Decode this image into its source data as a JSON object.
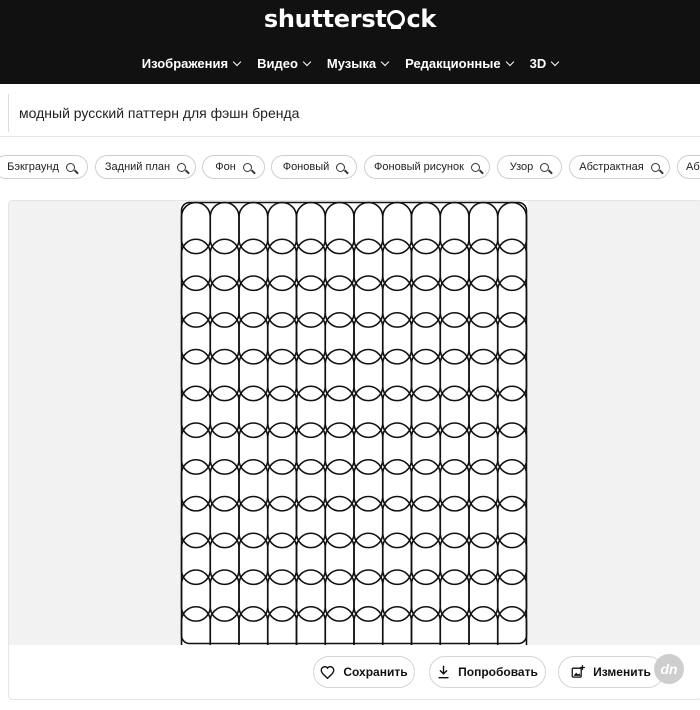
{
  "header": {
    "logo_left": "shutterst",
    "logo_right": "ck",
    "nav": [
      {
        "label": "Изображения"
      },
      {
        "label": "Видео"
      },
      {
        "label": "Музыка"
      },
      {
        "label": "Редакционные"
      },
      {
        "label": "3D"
      }
    ]
  },
  "search": {
    "query": "модный русский паттерн для фэшн бренда"
  },
  "chips": [
    {
      "label": "Бэкграунд"
    },
    {
      "label": "Задний план"
    },
    {
      "label": "Фон"
    },
    {
      "label": "Фоновый"
    },
    {
      "label": "Фоновый рисунок"
    },
    {
      "label": "Узор"
    },
    {
      "label": "Абстрактная"
    },
    {
      "label": "Аб"
    }
  ],
  "actions": {
    "save": "Сохранить",
    "try": "Попробовать",
    "edit": "Изменить"
  },
  "badge": "dn",
  "pattern": {
    "columns": 12,
    "rows": 12,
    "stroke_color": "#111111",
    "background": "#ffffff",
    "stage_color": "#f2f2f2"
  }
}
